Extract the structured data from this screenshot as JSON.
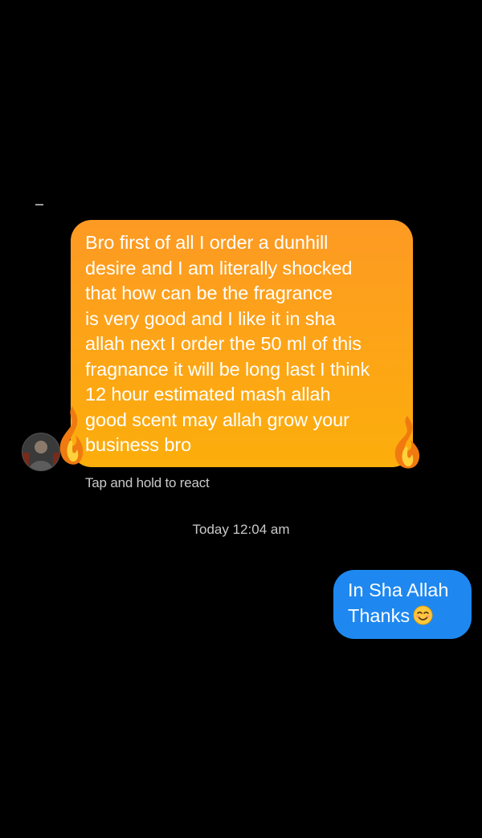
{
  "conversation": {
    "incoming_message": {
      "lines": [
        "Bro first of all I order a dunhill",
        "desire and I am literally shocked",
        "that how can be the fragrance",
        "is very good and I like it in sha",
        "allah next I order the 50 ml of this",
        "fragnance it will be long last I think",
        "12 hour estimated mash allah",
        "good scent may allah grow your",
        "business bro"
      ],
      "effect_icon": "fire-icon"
    },
    "react_hint": "Tap and hold to react",
    "timestamp": "Today 12:04 am",
    "outgoing_message": {
      "line1": "In Sha Allah",
      "line2": "Thanks",
      "emoji": "smiling-face-icon"
    }
  },
  "colors": {
    "background": "#000000",
    "incoming_bubble_top": "#fd9a23",
    "incoming_bubble_bottom": "#fcae0b",
    "outgoing_bubble": "#1e88f0",
    "meta_text": "#c9c9c9"
  }
}
